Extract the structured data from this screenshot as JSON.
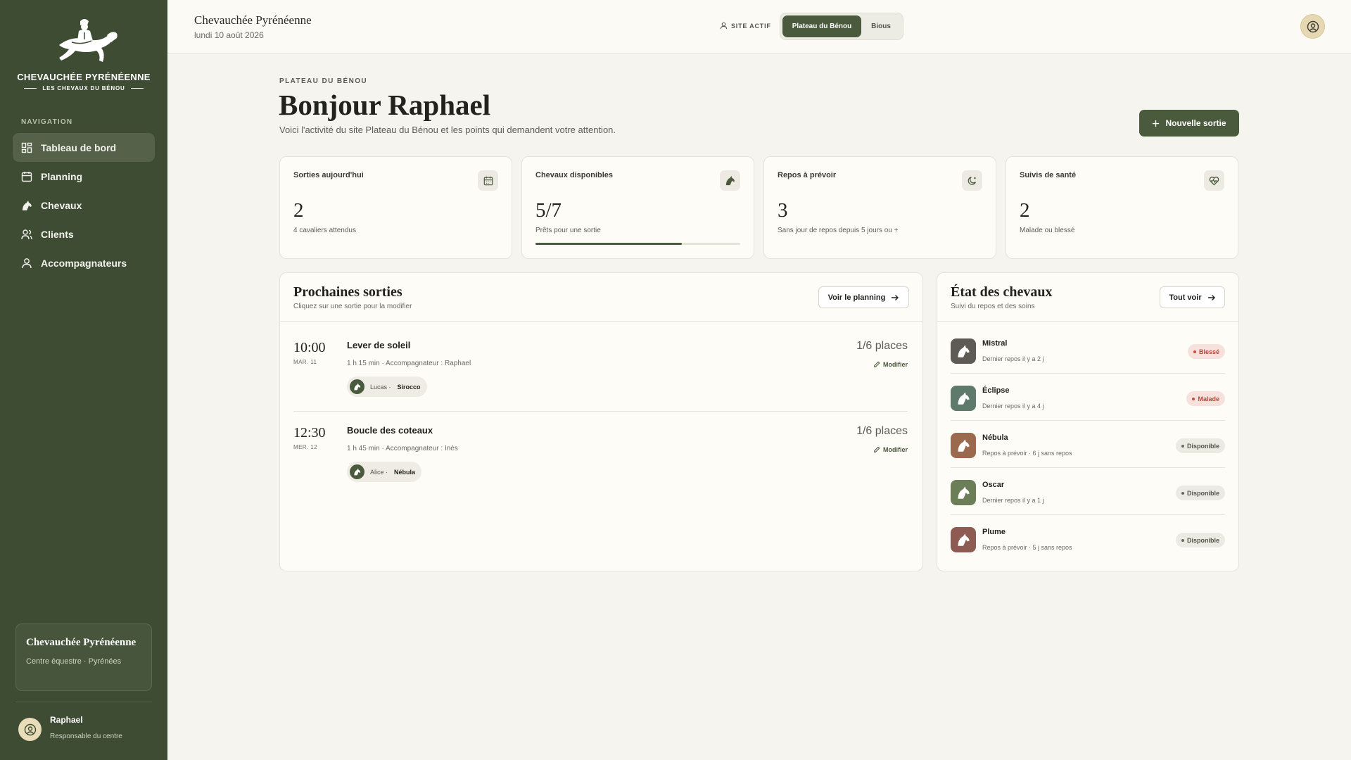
{
  "app": {
    "logo_title": "CHEVAUCHÉE PYRÉNÉENNE",
    "logo_sub": "LES CHEVAUX DU BÉNOU"
  },
  "sidebar": {
    "heading": "NAVIGATION",
    "items": [
      {
        "label": "Tableau de bord",
        "icon": "dashboard-icon",
        "active": true
      },
      {
        "label": "Planning",
        "icon": "calendar-icon"
      },
      {
        "label": "Chevaux",
        "icon": "horse-icon"
      },
      {
        "label": "Clients",
        "icon": "users-icon"
      },
      {
        "label": "Accompagnateurs",
        "icon": "user-icon"
      }
    ],
    "org": {
      "name": "Chevauchée Pyrénéenne",
      "meta": "Centre équestre · Pyrénées"
    },
    "user": {
      "name": "Raphael",
      "role": "Responsable du centre"
    }
  },
  "topbar": {
    "title": "Chevauchée Pyrénéenne",
    "date": "lundi 10 août 2026",
    "site_label": "SITE ACTIF",
    "sites": [
      "Plateau du Bénou",
      "Bious"
    ],
    "active_site": "Plateau du Bénou"
  },
  "header": {
    "eyebrow": "PLATEAU DU BÉNOU",
    "greeting": "Bonjour Raphael",
    "intro": "Voici l'activité du site Plateau du Bénou et les points qui demandent votre attention.",
    "new_button": "Nouvelle sortie"
  },
  "kpis": [
    {
      "label": "Sorties aujourd'hui",
      "value": "2",
      "note": "4 cavaliers attendus",
      "icon": "calendar-icon"
    },
    {
      "label": "Chevaux disponibles",
      "value": "5/7",
      "note": "Prêts pour une sortie",
      "icon": "horse-icon",
      "progress": 0.714
    },
    {
      "label": "Repos à prévoir",
      "value": "3",
      "note": "Sans jour de repos depuis 5 jours ou +",
      "icon": "moon-icon"
    },
    {
      "label": "Suivis de santé",
      "value": "2",
      "note": "Malade ou blessé",
      "icon": "heart-pulse-icon"
    }
  ],
  "sorties": {
    "title": "Prochaines sorties",
    "subtitle": "Cliquez sur une sortie pour la modifier",
    "button": "Voir le planning",
    "items": [
      {
        "time": "10:00",
        "date": "MAR. 11",
        "name": "Lever de soleil",
        "meta": "1 h 15 min · Accompagnateur : Raphael",
        "rider": "Lucas ·",
        "horse": "Sirocco",
        "places": "1/6 places",
        "edit": "Modifier"
      },
      {
        "time": "12:30",
        "date": "MER. 12",
        "name": "Boucle des coteaux",
        "meta": "1 h 45 min · Accompagnateur : Inès",
        "rider": "Alice ·",
        "horse": "Nébula",
        "places": "1/6 places",
        "edit": "Modifier"
      }
    ]
  },
  "chevaux": {
    "title": "État des chevaux",
    "subtitle": "Suivi du repos et des soins",
    "button": "Tout voir",
    "items": [
      {
        "name": "Mistral",
        "meta": "Dernier repos il y a 2 j",
        "status": "Blessé",
        "tone": "red",
        "color": "#5e5a56"
      },
      {
        "name": "Éclipse",
        "meta": "Dernier repos il y a 4 j",
        "status": "Malade",
        "tone": "red",
        "color": "#5e7a6c"
      },
      {
        "name": "Nébula",
        "meta": "Repos à prévoir · 6 j sans repos",
        "status": "Disponible",
        "tone": "grey",
        "color": "#9b6a4e"
      },
      {
        "name": "Oscar",
        "meta": "Dernier repos il y a 1 j",
        "status": "Disponible",
        "tone": "grey",
        "color": "#6b7e58"
      },
      {
        "name": "Plume",
        "meta": "Repos à prévoir · 5 j sans repos",
        "status": "Disponible",
        "tone": "grey",
        "color": "#8e5b52"
      }
    ]
  }
}
